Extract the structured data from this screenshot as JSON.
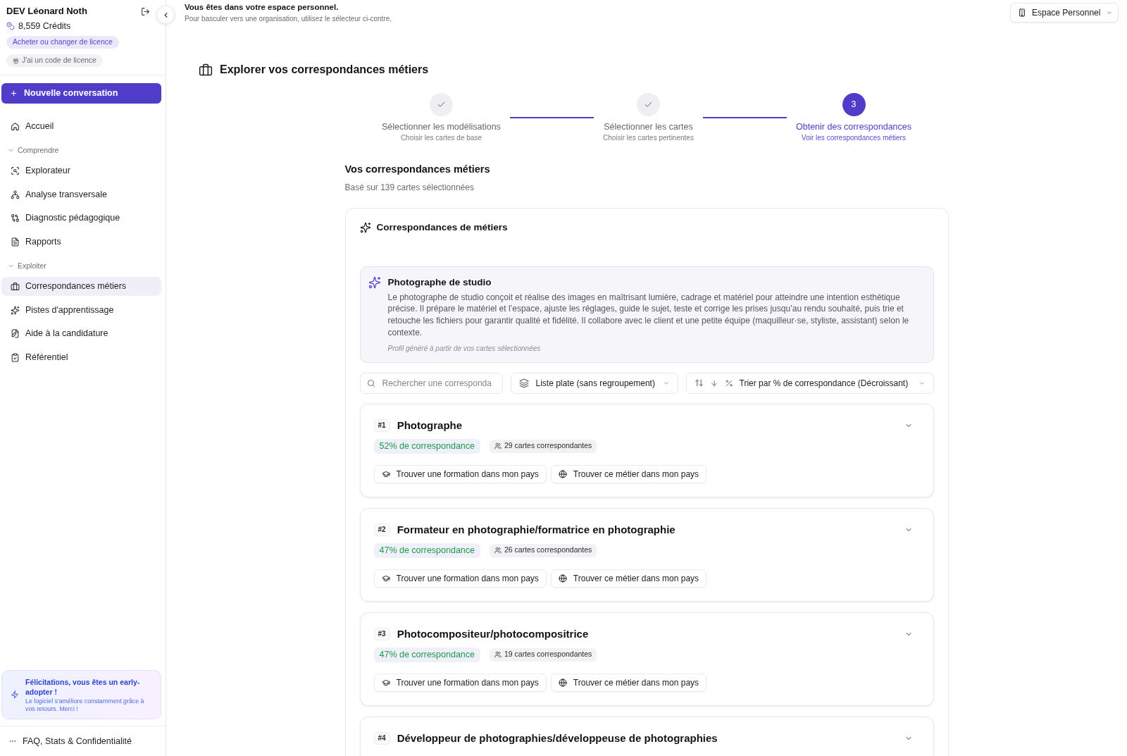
{
  "sidebar": {
    "user_name": "DEV Léonard Noth",
    "credits": "8,559 Crédits",
    "license_actions": [
      {
        "label": "Acheter ou changer de licence",
        "kind": "buy"
      },
      {
        "label": "J'ai un code de licence",
        "kind": "code"
      }
    ],
    "new_conversation": "Nouvelle conversation",
    "nav": [
      {
        "kind": "link",
        "label": "Accueil",
        "selected": false
      },
      {
        "kind": "group",
        "label": "Comprendre",
        "expanded": true,
        "children": [
          {
            "label": "Explorateur",
            "selected": false
          },
          {
            "label": "Analyse transversale",
            "selected": false
          },
          {
            "label": "Diagnostic pédagogique",
            "selected": false
          },
          {
            "label": "Rapports",
            "selected": false
          }
        ]
      },
      {
        "kind": "group",
        "label": "Exploiter",
        "expanded": true,
        "children": [
          {
            "label": "Correspondances métiers",
            "selected": true
          },
          {
            "label": "Pistes d'apprentissage",
            "selected": false
          },
          {
            "label": "Aide à la candidature",
            "selected": false
          },
          {
            "label": "Référentiel",
            "selected": false
          }
        ]
      }
    ],
    "notice": {
      "title": "Félicitations, vous êtes un early-adopter !",
      "text": "Le logiciel s'améliore constamment grâce à vos retours. Merci !"
    },
    "footer_link": "FAQ, Stats & Confidentialité"
  },
  "header": {
    "title": "Vous êtes dans votre espace personnel.",
    "subtitle": "Pour basculer vers une organisation, utilisez le sélecteur ci-contre.",
    "workspace_selector": "Espace Personnel"
  },
  "page_title": "Explorer vos correspondances métiers",
  "steps": [
    {
      "label": "Sélectionner les modélisations",
      "sublabel": "Choisir les cartes de base",
      "completed": true,
      "selected": false
    },
    {
      "label": "Sélectionner les cartes",
      "sublabel": "Choisir les cartes pertinentes",
      "completed": true,
      "selected": false
    },
    {
      "label": "Obtenir des correspondances",
      "sublabel": "Voir les correspondances métiers",
      "completed": false,
      "selected": true,
      "number": "3"
    }
  ],
  "results": {
    "title": "Vos correspondances métiers",
    "subtitle": "Basé sur 139 cartes sélectionnées",
    "panel_title": "Correspondances de métiers",
    "profile": {
      "title": "Photographe de studio",
      "description": "Le photographe de studio conçoit et réalise des images en maîtrisant lumière, cadrage et matériel pour atteindre une intention esthétique précise. Il prépare le matériel et l’espace, ajuste les réglages, guide le sujet, teste et corrige les prises jusqu’au rendu souhaité, puis trie et retouche les fichiers pour garantir qualité et fidélité. Il collabore avec le client et une petite équipe (maquilleur·se, styliste, assistant) selon le contexte.",
      "note": "Profil généré à partir de vos cartes sélectionnées"
    },
    "search": {
      "placeholder": "Rechercher une corresponda"
    },
    "grouping": "Liste plate (sans regroupement)",
    "sort": "Trier par % de correspondance (Décroissant)",
    "matches": [
      {
        "rank": "#1",
        "title": "Photographe",
        "expanded": false,
        "match": "52% de correspondance",
        "cards": "29 cartes correspondantes",
        "actions": [
          "Trouver une formation dans mon pays",
          "Trouver ce métier dans mon pays"
        ]
      },
      {
        "rank": "#2",
        "title": "Formateur en photographie/formatrice en photographie",
        "expanded": false,
        "match": "47% de correspondance",
        "cards": "26 cartes correspondantes",
        "actions": [
          "Trouver une formation dans mon pays",
          "Trouver ce métier dans mon pays"
        ]
      },
      {
        "rank": "#3",
        "title": "Photocompositeur/photocompositrice",
        "expanded": false,
        "match": "47% de correspondance",
        "cards": "19 cartes correspondantes",
        "actions": [
          "Trouver une formation dans mon pays",
          "Trouver ce métier dans mon pays"
        ]
      },
      {
        "rank": "#4",
        "title": "Développeur de photographies/développeuse de photographies",
        "expanded": false
      }
    ]
  }
}
